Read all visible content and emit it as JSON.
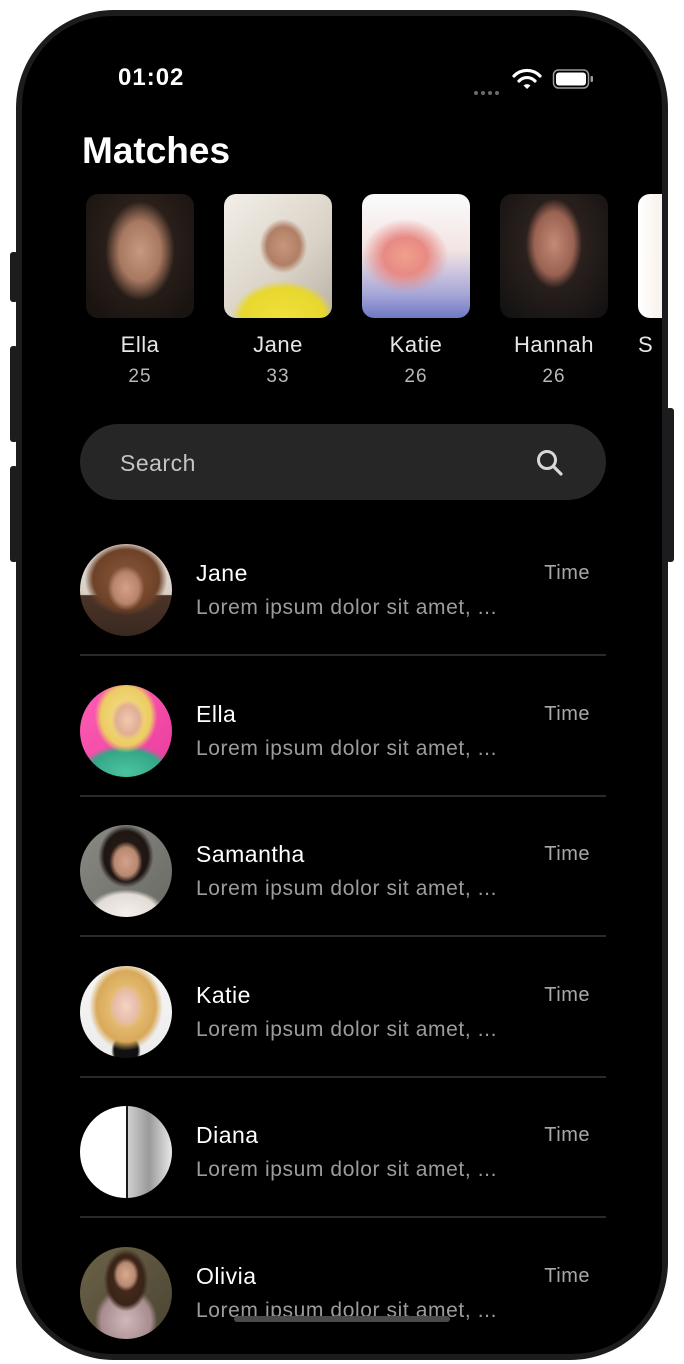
{
  "status_bar": {
    "time": "01:02"
  },
  "title": "Matches",
  "matches": [
    {
      "name": "Ella",
      "age": "25"
    },
    {
      "name": "Jane",
      "age": "33"
    },
    {
      "name": "Katie",
      "age": "26"
    },
    {
      "name": "Hannah",
      "age": "26"
    },
    {
      "name": "S",
      "age": ""
    }
  ],
  "search": {
    "placeholder": "Search",
    "value": ""
  },
  "chats": [
    {
      "name": "Jane",
      "time": "Time",
      "message": "Lorem ipsum dolor sit amet, ..."
    },
    {
      "name": "Ella",
      "time": "Time",
      "message": "Lorem ipsum dolor sit amet, ..."
    },
    {
      "name": "Samantha",
      "time": "Time",
      "message": "Lorem ipsum dolor sit amet, ..."
    },
    {
      "name": "Katie",
      "time": "Time",
      "message": "Lorem ipsum dolor sit amet, ..."
    },
    {
      "name": "Diana",
      "time": "Time",
      "message": "Lorem ipsum dolor sit amet, ..."
    },
    {
      "name": "Olivia",
      "time": "Time",
      "message": "Lorem ipsum dolor sit amet, ..."
    }
  ],
  "colors": {
    "background": "#000000",
    "search_bg": "#262626",
    "divider": "#2a2a2a",
    "secondary_text": "#9c9c9c"
  }
}
